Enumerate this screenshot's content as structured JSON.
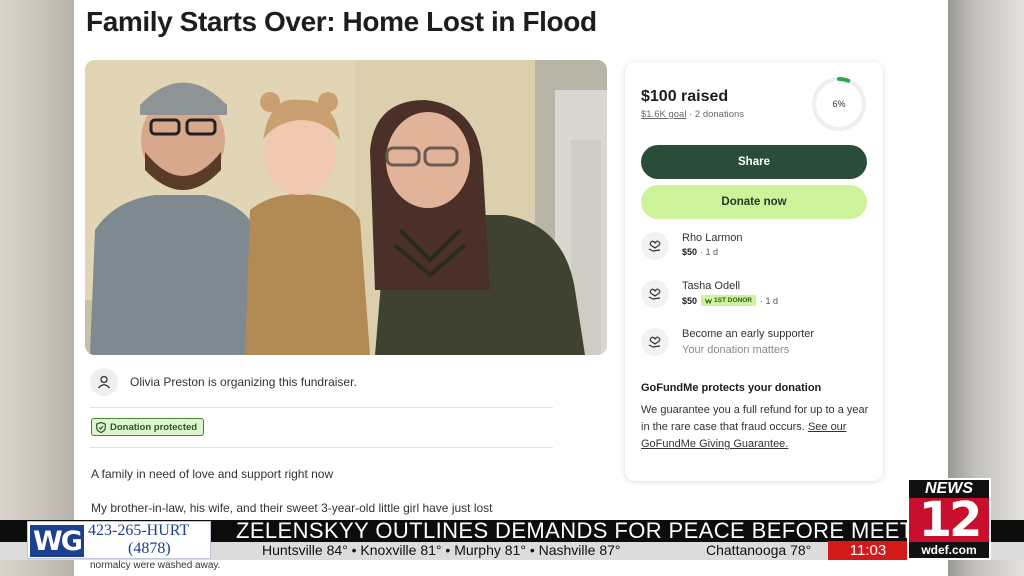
{
  "campaign": {
    "title": "Family Starts Over: Home Lost in Flood",
    "organizer_text": "Olivia Preston is organizing this fundraiser.",
    "protected_badge": "Donation protected",
    "story_line_1": "A family in need of love and support right now",
    "story_line_2": "My brother-in-law, his wife, and their sweet 3-year-old little girl have just lost",
    "story_line_3": "normalcy were washed away."
  },
  "donation_card": {
    "raised": "$100 raised",
    "goal": "$1.6K goal",
    "separator": "·",
    "donations": "2 donations",
    "progress_label": "6%",
    "progress_fraction": 0.06,
    "share_label": "Share",
    "donate_label": "Donate now",
    "donors": [
      {
        "name": "Rho Larmon",
        "amount": "$50",
        "time": "· 1 d",
        "badge": ""
      },
      {
        "name": "Tasha Odell",
        "amount": "$50",
        "time": "· 1 d",
        "badge": "1ST DONOR"
      }
    ],
    "early_title": "Become an early supporter",
    "early_sub": "Your donation matters",
    "protect_title": "GoFundMe protects your donation",
    "protect_text": "We guarantee you a full refund for up to a year in the rare case that fraud occurs.",
    "protect_link": "See our GoFundMe Giving Guarantee."
  },
  "broadcast": {
    "sponsor_logo": "WG",
    "sponsor_phone": "423-265-HURT",
    "sponsor_number": "(4878)",
    "headline": "ZELENSKYY OUTLINES DEMANDS FOR PEACE BEFORE MEETING",
    "weather": "Huntsville 84° • Knoxville 81° • Murphy 81° • Nashville 87°",
    "weather_current": "Chattanooga 78°",
    "time": "11:03",
    "station_top": "NEWS",
    "station_num": "12",
    "station_site": "wdef.com"
  },
  "colors": {
    "share_button": "#2a4d3a",
    "donate_button": "#cdf39a",
    "progress_ring": "#2fa84f",
    "clock_bg": "#d21a1a",
    "station_red": "#c8102e"
  }
}
